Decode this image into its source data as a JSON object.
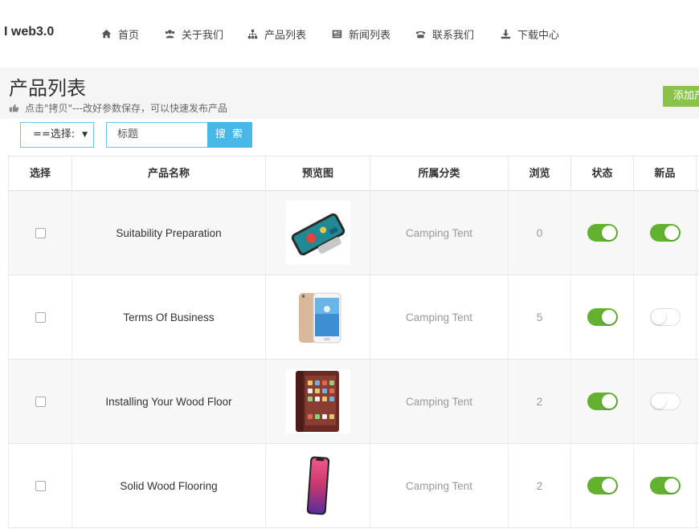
{
  "logo": "I web3.0",
  "nav": [
    {
      "label": "首页",
      "icon": "home-icon"
    },
    {
      "label": "关于我们",
      "icon": "users-icon"
    },
    {
      "label": "产品列表",
      "icon": "sitemap-icon"
    },
    {
      "label": "新闻列表",
      "icon": "newspaper-icon"
    },
    {
      "label": "联系我们",
      "icon": "phone-icon"
    },
    {
      "label": "下载中心",
      "icon": "download-icon"
    }
  ],
  "page": {
    "title": "产品列表",
    "subtitle": "点击\"拷贝\"---改好参数保存，可以快速发布产品",
    "add_button": "添加产品"
  },
  "search": {
    "select_value": "==选择:",
    "input_value": "标题",
    "button": "搜 索"
  },
  "table": {
    "headers": [
      "选择",
      "产品名称",
      "预览图",
      "所属分类",
      "浏览",
      "状态",
      "新品"
    ],
    "rows": [
      {
        "name": "Suitability Preparation",
        "category": "Camping Tent",
        "views": "0",
        "status": true,
        "new": true,
        "image": "phone-landscape-teal"
      },
      {
        "name": "Terms Of Business",
        "category": "Camping Tent",
        "views": "5",
        "status": true,
        "new": false,
        "image": "phone-gold"
      },
      {
        "name": "Installing Your Wood Floor",
        "category": "Camping Tent",
        "views": "2",
        "status": true,
        "new": false,
        "image": "phone-brown"
      },
      {
        "name": "Solid Wood Flooring",
        "category": "Camping Tent",
        "views": "2",
        "status": true,
        "new": true,
        "image": "phone-iphone-x"
      }
    ]
  }
}
